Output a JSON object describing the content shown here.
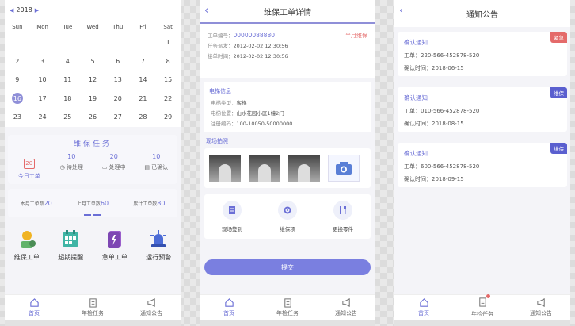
{
  "colors": {
    "accent": "#6b6fd6",
    "urgent": "#e46a6a",
    "tag_maint": "#5a5fcf"
  },
  "home": {
    "year": "2018",
    "weekdays": [
      "Sun",
      "Mon",
      "Tue",
      "Wed",
      "Thu",
      "Fri",
      "Sat"
    ],
    "days": [
      "",
      "",
      "",
      "",
      "",
      "",
      "1",
      "2",
      "3",
      "4",
      "5",
      "6",
      "7",
      "8",
      "9",
      "10",
      "11",
      "12",
      "13",
      "14",
      "15",
      "16",
      "17",
      "18",
      "19",
      "20",
      "21",
      "22",
      "23",
      "24",
      "25",
      "26",
      "27",
      "28",
      "29"
    ],
    "selected_day": "16",
    "task_title": "维保任务",
    "today_num": "20",
    "today_label": "今日工单",
    "pending_num": "10",
    "pending_label": "待处理",
    "processing_num": "20",
    "processing_label": "处理中",
    "confirmed_num": "10",
    "confirmed_label": "已确认",
    "month_label": "本月工单数",
    "month_num": "20",
    "last_month_label": "上月工单数",
    "last_month_num": "60",
    "total_label": "累计工单数",
    "total_num": "80",
    "quick": [
      "维保工单",
      "超期提醒",
      "急单工单",
      "运行预警"
    ]
  },
  "tabs": [
    "首页",
    "年检任务",
    "通知公告"
  ],
  "detail": {
    "title": "维保工单详情",
    "order_no_label": "工单编号：",
    "order_no": "00000088880",
    "order_type": "半月维保",
    "dispatch_label": "任务派发：",
    "dispatch_time": "2012-02-02 12:30:56",
    "accept_label": "接单时间：",
    "accept_time": "2012-02-02 12:30:56",
    "elevator_section": "电梯信息",
    "type_label": "电梯类型：",
    "type_value": "客梯",
    "location_label": "电梯位置：",
    "location_value": "山水花园小区1幢2门",
    "reg_label": "注册编码：",
    "reg_value": "100-10050-50000000",
    "photo_section": "现场拍照",
    "actions": [
      "现场签到",
      "维保项",
      "更换零件"
    ],
    "submit": "提交"
  },
  "notices": {
    "title": "通知公告",
    "items": [
      {
        "title": "确认通知",
        "tag": "紧急",
        "order_label": "工单：",
        "order": "220-566-452878-520",
        "time_label": "确认时间：",
        "time": "2018-06-15"
      },
      {
        "title": "确认通知",
        "tag": "维保",
        "order_label": "工单：",
        "order": "010-566-452878-520",
        "time_label": "确认时间：",
        "time": "2018-08-15"
      },
      {
        "title": "确认通知",
        "tag": "维保",
        "order_label": "工单：",
        "order": "600-566-452878-520",
        "time_label": "确认时间：",
        "time": "2018-09-15"
      }
    ]
  }
}
